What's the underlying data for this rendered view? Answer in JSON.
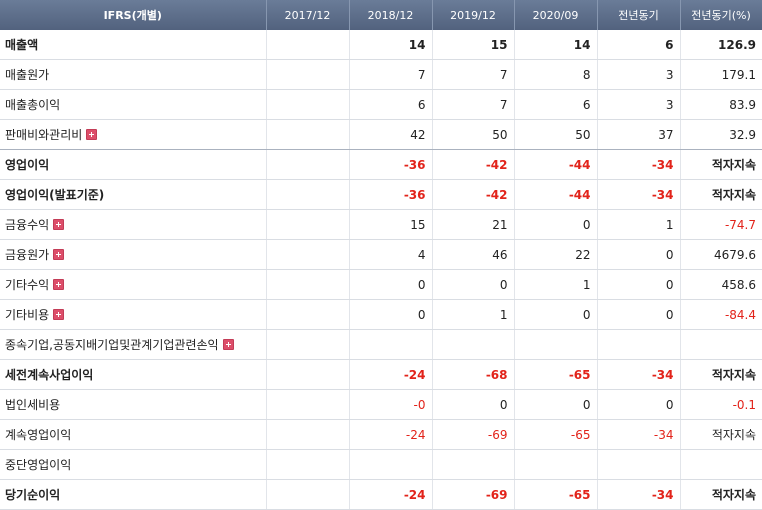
{
  "table": {
    "headers": [
      "IFRS(개별)",
      "2017/12",
      "2018/12",
      "2019/12",
      "2020/09",
      "전년동기",
      "전년동기(%)"
    ],
    "rows": [
      {
        "label": "매출액",
        "bold": true,
        "expand": false,
        "cells": [
          "",
          "14",
          "15",
          "14",
          "6",
          "126.9"
        ]
      },
      {
        "label": "매출원가",
        "bold": false,
        "expand": false,
        "cells": [
          "",
          "7",
          "7",
          "8",
          "3",
          "179.1"
        ]
      },
      {
        "label": "매출총이익",
        "bold": false,
        "expand": false,
        "cells": [
          "",
          "6",
          "7",
          "6",
          "3",
          "83.9"
        ]
      },
      {
        "label": "판매비와관리비",
        "bold": false,
        "expand": true,
        "sep": true,
        "cells": [
          "",
          "42",
          "50",
          "50",
          "37",
          "32.9"
        ]
      },
      {
        "label": "영업이익",
        "bold": true,
        "expand": false,
        "cells": [
          "",
          "-36",
          "-42",
          "-44",
          "-34",
          "적자지속"
        ]
      },
      {
        "label": "영업이익(발표기준)",
        "bold": true,
        "expand": false,
        "cells": [
          "",
          "-36",
          "-42",
          "-44",
          "-34",
          "적자지속"
        ]
      },
      {
        "label": "금융수익",
        "bold": false,
        "expand": true,
        "cells": [
          "",
          "15",
          "21",
          "0",
          "1",
          "-74.7"
        ]
      },
      {
        "label": "금융원가",
        "bold": false,
        "expand": true,
        "cells": [
          "",
          "4",
          "46",
          "22",
          "0",
          "4679.6"
        ]
      },
      {
        "label": "기타수익",
        "bold": false,
        "expand": true,
        "cells": [
          "",
          "0",
          "0",
          "1",
          "0",
          "458.6"
        ]
      },
      {
        "label": "기타비용",
        "bold": false,
        "expand": true,
        "cells": [
          "",
          "0",
          "1",
          "0",
          "0",
          "-84.4"
        ]
      },
      {
        "label": "종속기업,공동지배기업및관계기업관련손익",
        "bold": false,
        "expand": true,
        "cells": [
          "",
          "",
          "",
          "",
          "",
          ""
        ]
      },
      {
        "label": "세전계속사업이익",
        "bold": true,
        "expand": false,
        "cells": [
          "",
          "-24",
          "-68",
          "-65",
          "-34",
          "적자지속"
        ]
      },
      {
        "label": "법인세비용",
        "bold": false,
        "expand": false,
        "cells": [
          "",
          "-0",
          "0",
          "0",
          "0",
          "-0.1"
        ]
      },
      {
        "label": "계속영업이익",
        "bold": false,
        "expand": false,
        "cells": [
          "",
          "-24",
          "-69",
          "-65",
          "-34",
          "적자지속"
        ]
      },
      {
        "label": "중단영업이익",
        "bold": false,
        "expand": false,
        "cells": [
          "",
          "",
          "",
          "",
          "",
          ""
        ]
      },
      {
        "label": "당기순이익",
        "bold": true,
        "expand": false,
        "cells": [
          "",
          "-24",
          "-69",
          "-65",
          "-34",
          "적자지속"
        ]
      }
    ]
  },
  "icons": {
    "expand": "plus-square-icon"
  },
  "colors": {
    "header_bg": "#5d6d8a",
    "negative": "#e2231a",
    "expand_icon": "#dd4e6a"
  }
}
